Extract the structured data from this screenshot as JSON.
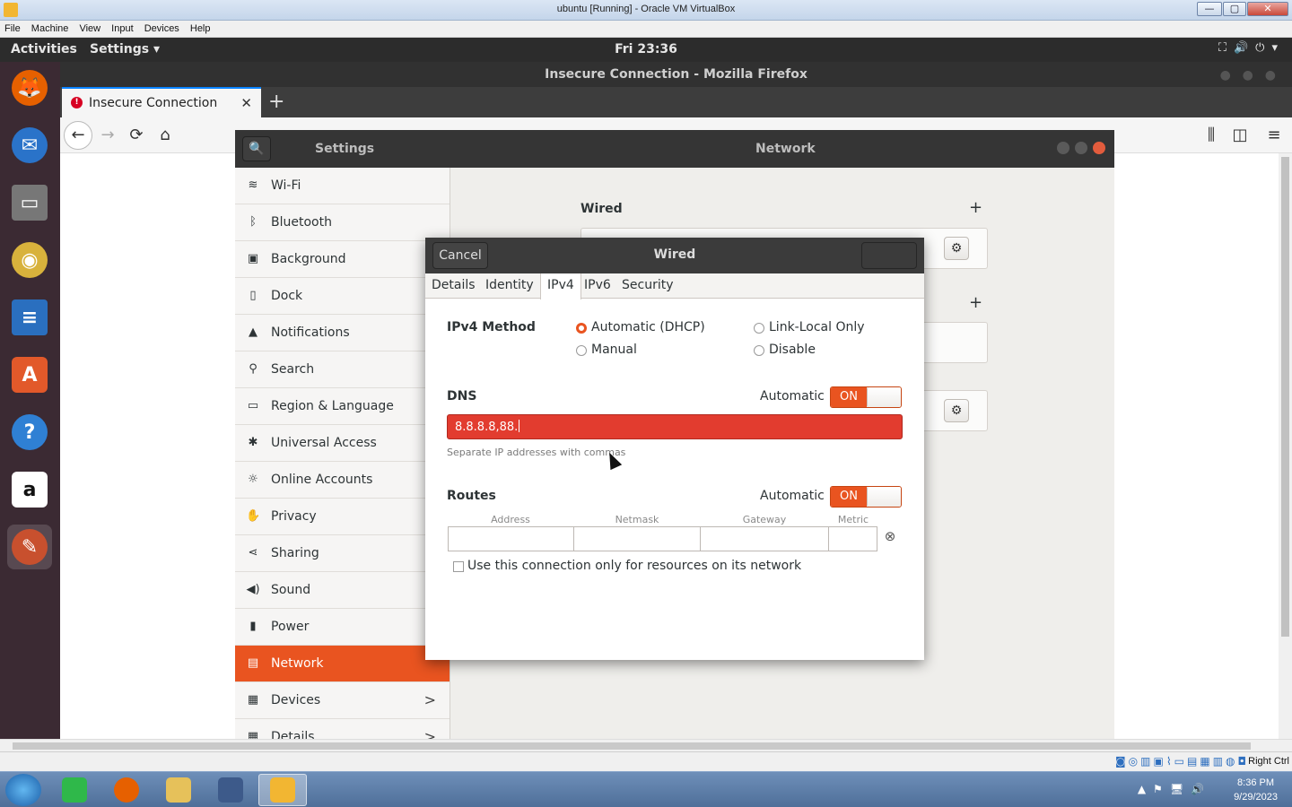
{
  "vbox": {
    "title": "ubuntu [Running] - Oracle VM VirtualBox",
    "menu": [
      "File",
      "Machine",
      "View",
      "Input",
      "Devices",
      "Help"
    ],
    "window_buttons": {
      "minimize": "—",
      "maximize": "▢",
      "close": "✕"
    },
    "host_key": "Right Ctrl"
  },
  "ubuntu_topbar": {
    "activities": "Activities",
    "app_menu": "Settings ▾",
    "clock": "Fri 23:36",
    "system_icons": "⛶🔊⏻▾"
  },
  "dock": {
    "items": [
      {
        "name": "firefox",
        "glyph": "🦊",
        "color": "#e66000"
      },
      {
        "name": "thunderbird",
        "glyph": "✉",
        "color": "#2a73c9"
      },
      {
        "name": "files",
        "glyph": "▭",
        "color": "#777777"
      },
      {
        "name": "rhythmbox",
        "glyph": "◉",
        "color": "#d8b23c"
      },
      {
        "name": "libreoffice-writer",
        "glyph": "≡",
        "color": "#2a6fbf"
      },
      {
        "name": "ubuntu-software",
        "glyph": "A",
        "color": "#e2592a"
      },
      {
        "name": "help",
        "glyph": "?",
        "color": "#2f80d4"
      },
      {
        "name": "amazon",
        "glyph": "a",
        "color": "#ffffff"
      },
      {
        "name": "settings",
        "glyph": "✎",
        "color": "#c8502e"
      }
    ]
  },
  "firefox": {
    "window_title": "Insecure Connection - Mozilla Firefox",
    "tab_label": "Insecure Connection",
    "tab_close": "✕",
    "new_tab": "+",
    "nav": {
      "back": "←",
      "forward": "→",
      "reload": "⟳",
      "home": "⌂",
      "library": "⫼",
      "sidebar": "◫",
      "menu": "≡"
    }
  },
  "settings": {
    "title": "Settings",
    "panel_title": "Network",
    "search_icon": "🔍",
    "sidebar": [
      {
        "label": "Wi-Fi",
        "icon": "wifi"
      },
      {
        "label": "Bluetooth",
        "icon": "bluetooth"
      },
      {
        "label": "Background",
        "icon": "background"
      },
      {
        "label": "Dock",
        "icon": "dock"
      },
      {
        "label": "Notifications",
        "icon": "bell"
      },
      {
        "label": "Search",
        "icon": "search"
      },
      {
        "label": "Region & Language",
        "icon": "region"
      },
      {
        "label": "Universal Access",
        "icon": "accessibility"
      },
      {
        "label": "Online Accounts",
        "icon": "accounts"
      },
      {
        "label": "Privacy",
        "icon": "hand"
      },
      {
        "label": "Sharing",
        "icon": "share"
      },
      {
        "label": "Sound",
        "icon": "speaker"
      },
      {
        "label": "Power",
        "icon": "power"
      },
      {
        "label": "Network",
        "icon": "network",
        "selected": true
      },
      {
        "label": "Devices",
        "icon": "devices",
        "chevron": ">"
      },
      {
        "label": "Details",
        "icon": "details",
        "chevron": ">"
      }
    ],
    "network": {
      "wired_title": "Wired",
      "add": "+",
      "gear": "⚙"
    }
  },
  "dialog": {
    "cancel": "Cancel",
    "title": "Wired",
    "tabs": [
      "Details",
      "Identity",
      "IPv4",
      "IPv6",
      "Security"
    ],
    "active_tab": "IPv4",
    "ipv4_method_label": "IPv4 Method",
    "methods": [
      {
        "label": "Automatic (DHCP)",
        "checked": true
      },
      {
        "label": "Link-Local Only",
        "checked": false
      },
      {
        "label": "Manual",
        "checked": false
      },
      {
        "label": "Disable",
        "checked": false
      }
    ],
    "dns_label": "DNS",
    "dns_automatic_label": "Automatic",
    "dns_switch": "ON",
    "dns_value": "8.8.8.8,88.",
    "dns_hint": "Separate IP addresses with commas",
    "routes_label": "Routes",
    "routes_automatic_label": "Automatic",
    "routes_switch": "ON",
    "route_columns": [
      "Address",
      "Netmask",
      "Gateway",
      "Metric"
    ],
    "route_delete": "⊗",
    "only_resources_label": "Use this connection only for resources on its network",
    "only_resources_checked": false
  },
  "host_taskbar": {
    "time": "8:36 PM",
    "date": "9/29/2023",
    "tray_icons": "▲⚑🖥🔊"
  }
}
